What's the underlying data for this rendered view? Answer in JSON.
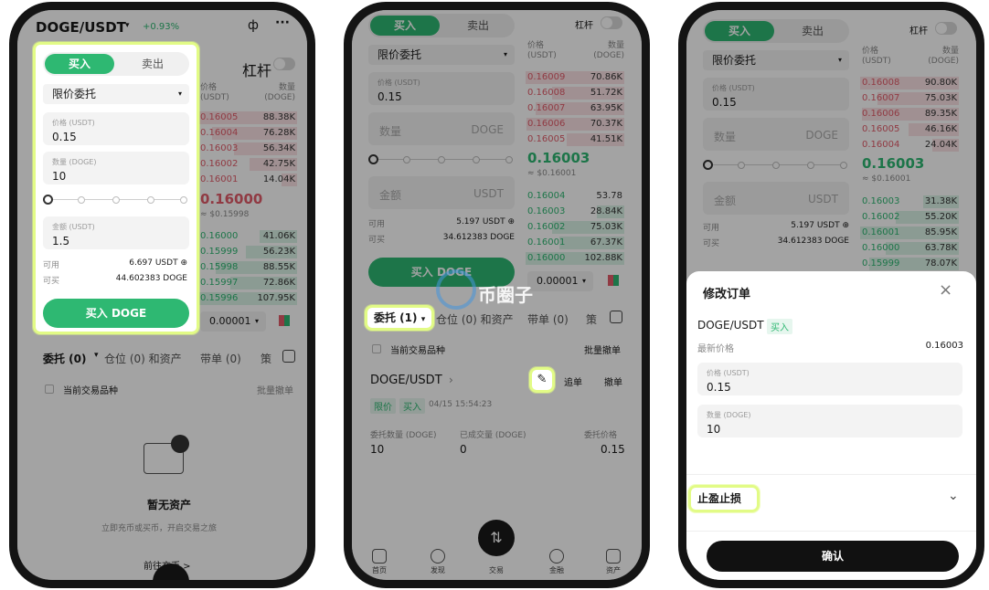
{
  "phone1": {
    "pair": "DOGE/USDT",
    "change": "+0.93%",
    "buy_tab": "买入",
    "sell_tab": "卖出",
    "leverage": "杠杆",
    "order_type": "限价委托",
    "price_label": "价格 (USDT)",
    "price_value": "0.15",
    "qty_label": "数量 (DOGE)",
    "qty_value": "10",
    "amount_label": "金额 (USDT)",
    "amount_value": "1.5",
    "avail_label": "可用",
    "avail_value": "6.697 USDT",
    "canbuy_label": "可买",
    "canbuy_value": "44.602383 DOGE",
    "buy_button": "买入 DOGE",
    "book_price_header": "价格\n(USDT)",
    "book_qty_header": "数量\n(DOGE)",
    "asks": [
      {
        "p": "0.16005",
        "q": "88.38K"
      },
      {
        "p": "0.16004",
        "q": "76.28K"
      },
      {
        "p": "0.16003",
        "q": "56.34K"
      },
      {
        "p": "0.16002",
        "q": "42.75K"
      },
      {
        "p": "0.16001",
        "q": "14.04K"
      }
    ],
    "last_price": "0.16000",
    "last_price_fiat": "≈ $0.15998",
    "bids": [
      {
        "p": "0.16000",
        "q": "41.06K"
      },
      {
        "p": "0.15999",
        "q": "56.23K"
      },
      {
        "p": "0.15998",
        "q": "88.55K"
      },
      {
        "p": "0.15997",
        "q": "72.86K"
      },
      {
        "p": "0.15996",
        "q": "107.95K"
      }
    ],
    "depth_select": "0.00001",
    "tab_orders": "委托 (0)",
    "tab_positions": "仓位 (0) 和资产",
    "tab_bands": "带单 (0)",
    "tab_more": "策",
    "current_pair_only": "当前交易品种",
    "batch_cancel": "批量撤单",
    "empty_title": "暂无资产",
    "empty_sub": "立即充币或买币，开启交易之旅",
    "go_trade": "前往充币 >"
  },
  "phone2": {
    "buy_tab": "买入",
    "sell_tab": "卖出",
    "leverage": "杠杆",
    "order_type": "限价委托",
    "price_label": "价格 (USDT)",
    "price_value": "0.15",
    "qty_placeholder": "数量",
    "qty_unit": "DOGE",
    "amount_placeholder": "金额",
    "amount_unit": "USDT",
    "avail_label": "可用",
    "avail_value": "5.197 USDT",
    "canbuy_label": "可买",
    "canbuy_value": "34.612383 DOGE",
    "buy_button": "买入 DOGE",
    "book_price_header": "价格\n(USDT)",
    "book_qty_header": "数量\n(DOGE)",
    "asks": [
      {
        "p": "0.16009",
        "q": "70.86K"
      },
      {
        "p": "0.16008",
        "q": "51.72K"
      },
      {
        "p": "0.16007",
        "q": "63.95K"
      },
      {
        "p": "0.16006",
        "q": "70.37K"
      },
      {
        "p": "0.16005",
        "q": "41.51K"
      }
    ],
    "last_price": "0.16003",
    "last_price_fiat": "≈ $0.16001",
    "bids": [
      {
        "p": "0.16004",
        "q": "53.78"
      },
      {
        "p": "0.16003",
        "q": "28.84K"
      },
      {
        "p": "0.16002",
        "q": "75.03K"
      },
      {
        "p": "0.16001",
        "q": "67.37K"
      },
      {
        "p": "0.16000",
        "q": "102.88K"
      }
    ],
    "depth_select": "0.00001",
    "tab_orders": "委托 (1)",
    "tab_positions": "仓位 (0) 和资产",
    "tab_bands": "带单 (0)",
    "tab_more": "策",
    "current_pair_only": "当前交易品种",
    "batch_cancel": "批量撤单",
    "order_pair": "DOGE/USDT",
    "chase": "追单",
    "cancel": "撤单",
    "tag_limit": "限价",
    "tag_buy": "买入",
    "order_time": "04/15 15:54:23",
    "col_qty": "委托数量 (DOGE)",
    "col_filled": "已成交量 (DOGE)",
    "col_price": "委托价格",
    "val_qty": "10",
    "val_filled": "0",
    "val_price": "0.15",
    "watermark": "币圈子",
    "nav": [
      "首页",
      "发现",
      "交易",
      "金融",
      "资产"
    ]
  },
  "phone3": {
    "buy_tab": "买入",
    "sell_tab": "卖出",
    "leverage": "杠杆",
    "order_type": "限价委托",
    "price_label": "价格 (USDT)",
    "price_value": "0.15",
    "qty_placeholder": "数量",
    "qty_unit": "DOGE",
    "amount_placeholder": "金额",
    "amount_unit": "USDT",
    "avail_label": "可用",
    "avail_value": "5.197 USDT",
    "canbuy_label": "可买",
    "canbuy_value": "34.612383 DOGE",
    "book_price_header": "价格\n(USDT)",
    "book_qty_header": "数量\n(DOGE)",
    "asks": [
      {
        "p": "0.16008",
        "q": "90.80K"
      },
      {
        "p": "0.16007",
        "q": "75.03K"
      },
      {
        "p": "0.16006",
        "q": "89.35K"
      },
      {
        "p": "0.16005",
        "q": "46.16K"
      },
      {
        "p": "0.16004",
        "q": "24.04K"
      }
    ],
    "last_price": "0.16003",
    "last_price_fiat": "≈ $0.16001",
    "bids": [
      {
        "p": "0.16003",
        "q": "31.38K"
      },
      {
        "p": "0.16002",
        "q": "55.20K"
      },
      {
        "p": "0.16001",
        "q": "85.95K"
      },
      {
        "p": "0.16000",
        "q": "63.78K"
      },
      {
        "p": "0.15999",
        "q": "78.07K"
      }
    ],
    "sheet_title": "修改订单",
    "sheet_pair": "DOGE/USDT",
    "sheet_tag": "买入",
    "latest_price_label": "最新价格",
    "latest_price_value": "0.16003",
    "qty_label": "数量 (DOGE)",
    "qty_value": "10",
    "tp_sl": "止盈止损",
    "confirm": "确认"
  },
  "colors": {
    "green": "#2eb872",
    "red": "#e25c6a",
    "highlight": "#e2fb86"
  }
}
